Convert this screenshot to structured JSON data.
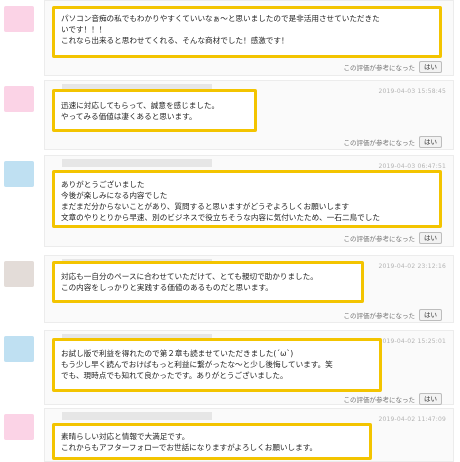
{
  "reviews": [
    {
      "timestamp": "",
      "avatar_color": "#fbd3e6",
      "lines": [
        "パソコン音痴の私でもわかりやすくていいなぁ～と思いましたので是非活用させていただきた",
        "いです！！！",
        "これなら出来ると思わせてくれる、そんな商材でした！感激です！"
      ],
      "helpful_label": "この評価が参考になった",
      "yes_label": "はい"
    },
    {
      "timestamp": "2019-04-03 15:58:45",
      "avatar_color": "#fbd3e6",
      "lines": [
        "迅速に対応してもらって、誠意を感じました。",
        "やってみる価値は凄くあると思います。"
      ],
      "helpful_label": "この評価が参考になった",
      "yes_label": "はい"
    },
    {
      "timestamp": "2019-04-03 06:47:51",
      "avatar_color": "#bfe0f2",
      "lines": [
        "ありがとうございました",
        "今後が楽しみになる内容でした",
        "まだまだ分からないことがあり、質問すると思いますがどうぞよろしくお願いします",
        "文章のやりとりから早速、別のビジネスで役立ちそうな内容に気付いたため、一石二鳥でした"
      ],
      "helpful_label": "この評価が参考になった",
      "yes_label": "はい"
    },
    {
      "timestamp": "2019-04-02 23:12:16",
      "avatar_color": "#e3dcd8",
      "lines": [
        "対応も一自分のペースに合わせていただけて、とても親切で助かりました。",
        "この内容をしっかりと実践する価値のあるものだと思います。"
      ],
      "helpful_label": "この評価が参考になった",
      "yes_label": "はい"
    },
    {
      "timestamp": "2019-04-02 15:25:01",
      "avatar_color": "#bfe0f2",
      "lines": [
        "お試し版で利益を得れたので第２章も読ませていただきました(´ω`)",
        "もう少し早く読んでおけばもっと利益に繋がったな～と少し後悔しています。笑",
        "でも、現時点でも知れて良かったです。ありがとうございました。"
      ],
      "helpful_label": "この評価が参考になった",
      "yes_label": "はい"
    },
    {
      "timestamp": "2019-04-02 11:47:09",
      "avatar_color": "#fbd3e6",
      "lines": [
        "素晴らしい対応と情報で大満足です。",
        "これからもアフターフォローでお世話になりますがよろしくお願いします。"
      ],
      "helpful_label": "",
      "yes_label": ""
    }
  ]
}
